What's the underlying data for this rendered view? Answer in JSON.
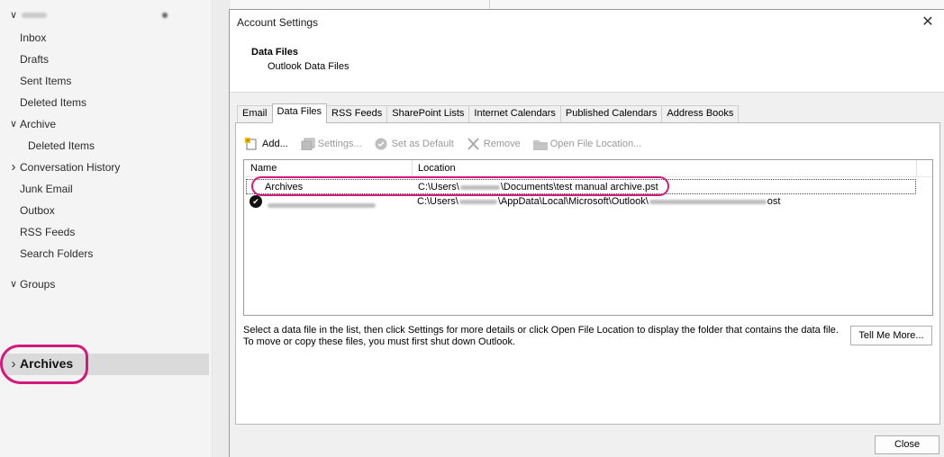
{
  "folder_pane": {
    "account_label": "",
    "folders": [
      {
        "label": "Inbox"
      },
      {
        "label": "Drafts"
      },
      {
        "label": "Sent Items"
      },
      {
        "label": "Deleted Items"
      },
      {
        "label": "Archive"
      },
      {
        "label": "Deleted Items"
      },
      {
        "label": "Conversation History"
      },
      {
        "label": "Junk Email"
      },
      {
        "label": "Outbox"
      },
      {
        "label": "RSS Feeds"
      },
      {
        "label": "Search Folders"
      }
    ],
    "groups_label": "Groups",
    "archives_label": "Archives"
  },
  "dialog": {
    "title": "Account Settings",
    "close_glyph": "✕",
    "header_title": "Data Files",
    "header_subtitle": "Outlook Data Files",
    "tabs": [
      {
        "label": "Email"
      },
      {
        "label": "Data Files"
      },
      {
        "label": "RSS Feeds"
      },
      {
        "label": "SharePoint Lists"
      },
      {
        "label": "Internet Calendars"
      },
      {
        "label": "Published Calendars"
      },
      {
        "label": "Address Books"
      }
    ],
    "active_tab": "Data Files",
    "toolbar": {
      "add": "Add...",
      "settings": "Settings...",
      "set_default": "Set as Default",
      "remove": "Remove",
      "open_location": "Open File Location..."
    },
    "list": {
      "col_name": "Name",
      "col_location": "Location",
      "rows": [
        {
          "name": "Archives",
          "location": "C:\\Users\\",
          "location_tail": "\\Documents\\test manual archive.pst",
          "is_default": false
        },
        {
          "name": "",
          "location": "C:\\Users\\",
          "location_tail": "\\AppData\\Local\\Microsoft\\Outlook\\",
          "location_end": "ost",
          "is_default": true
        }
      ]
    },
    "help_text": "Select a data file in the list, then click Settings for more details or click Open File Location to display the folder that contains the data file. To move or copy these files, you must first shut down Outlook.",
    "tell_me_button": "Tell Me More...",
    "close_button": "Close"
  },
  "colors": {
    "annotation": "#d4197c",
    "selected_folder_bg": "#dadada"
  }
}
